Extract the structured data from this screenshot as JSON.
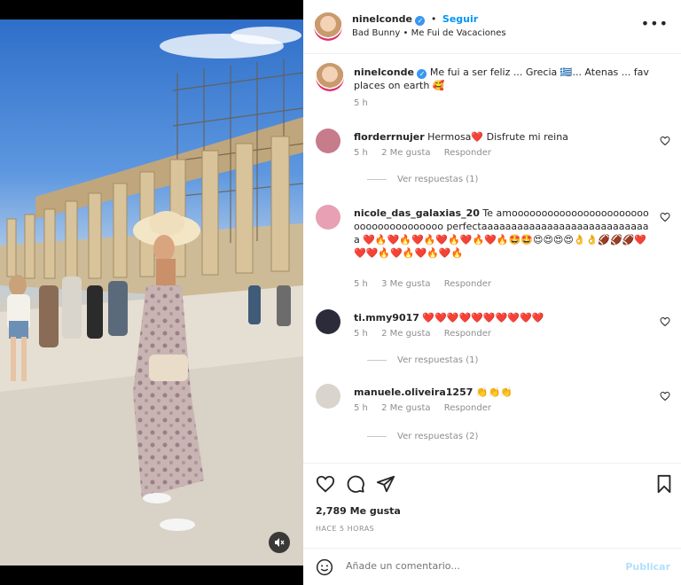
{
  "post": {
    "username": "ninelconde",
    "follow_label": "Seguir",
    "audio": "Bad Bunny • Me Fui de Vacaciones",
    "caption": "Me fui a ser feliz ... Grecia 🇬🇷... Atenas ... fav places on earth 🥰",
    "caption_time": "5 h",
    "likes": "2,789 Me gusta",
    "time_ago": "HACE 5 HORAS",
    "comment_placeholder": "Añade un comentario...",
    "publish_label": "Publicar"
  },
  "comments": [
    {
      "username": "florderrnujer",
      "text": "Hermosa❤️ Disfrute mi reina",
      "time": "5 h",
      "likes": "2 Me gusta",
      "reply": "Responder",
      "view_replies": "Ver respuestas (1)"
    },
    {
      "username": "nicole_das_galaxias_20",
      "text": "Te amoooooooooooooooooooooooooooooooooooooo perfectaaaaaaaaaaaaaaaaaaaaaaaaaaaaa ❤️🔥❤️🔥❤️🔥❤️🔥❤️🔥❤️🔥🤩🤩😍😍😍😍👌👌🏈🏈🏈❤️❤️❤️🔥❤️🔥❤️🔥❤️🔥",
      "time": "5 h",
      "likes": "3 Me gusta",
      "reply": "Responder"
    },
    {
      "username": "ti.mmy9017",
      "text": "❤️❤️❤️❤️❤️❤️❤️❤️❤️❤️",
      "time": "5 h",
      "likes": "2 Me gusta",
      "reply": "Responder",
      "view_replies": "Ver respuestas (1)"
    },
    {
      "username": "manuele.oliveira1257",
      "text": "👏👏👏",
      "time": "5 h",
      "likes": "2 Me gusta",
      "reply": "Responder",
      "view_replies": "Ver respuestas (2)"
    }
  ],
  "colors": {
    "accent": "#0095f6",
    "muted": "#8e8e8e",
    "text": "#262626"
  }
}
